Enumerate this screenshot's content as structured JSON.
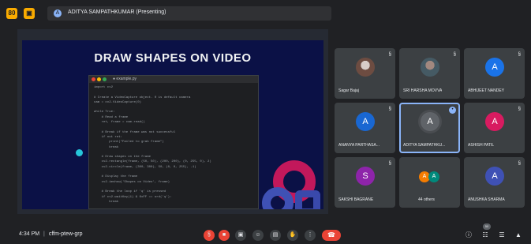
{
  "topbar": {
    "btn1": "80",
    "btn2": "▣",
    "presenter_initial": "A",
    "presenter_text": "ADITYA SAMPATHKUMAR (Presenting)"
  },
  "slide": {
    "title": "DRAW SHAPES ON VIDEO",
    "code_tab": "● example.py",
    "code": "import cv2\n\n# Create a VideoCapture object. 0 is default camera\ncam = cv2.VideoCapture(0)\n\nwhile True:\n    # Read a frame\n    ret, frame = cam.read()\n\n    # Break if the frame was not successful\n    if not ret:\n        print(\"Failed to grab frame\")\n        break\n\n    # Draw shapes on the frame\n    cv2.rectangle(frame, (50, 50), (200, 200), (0, 255, 0), 2)\n    cv2.circle(frame, (300, 300), 50, (0, 0, 255), -1)\n\n    # Display the frame\n    cv2.imshow('Shapes on Video', frame)\n\n    # Break the loop if 'q' is pressed\n    if cv2.waitKey(1) & 0xFF == ord('q'):\n        break\n\n# Release the VideoCapture object and close all windows\ncam.release()\ncv2.destroyAllWindows()"
  },
  "participants": [
    {
      "name": "Sagar Bajaj",
      "avatar": "",
      "muted": "§"
    },
    {
      "name": "SRI HARSHA MOVVA",
      "avatar": "",
      "muted": "§"
    },
    {
      "name": "ABHIJEET NANDEY",
      "avatar": "A",
      "muted": "§",
      "color": "#1a73e8"
    },
    {
      "name": "ANANYA PARTHASA...",
      "avatar": "A",
      "muted": "§",
      "color": "#1967d2"
    },
    {
      "name": "ADITYA SAMPATHKU...",
      "avatar": "A",
      "color": "#5f6368"
    },
    {
      "name": "ASHISH PATIL",
      "avatar": "A",
      "muted": "§",
      "color": "#d81b60"
    },
    {
      "name": "SAKSHI BAGRANE",
      "avatar": "S",
      "muted": "§",
      "color": "#8e24aa"
    },
    {
      "name": "44 others",
      "avatar": ""
    },
    {
      "name": "ANUSHKA SHARMA",
      "avatar": "A",
      "muted": "§",
      "color": "#3f51b5"
    }
  ],
  "others_minis": [
    "A",
    "A"
  ],
  "bottom": {
    "time": "4:34 PM",
    "sep": "|",
    "code": "cffm-ptew-grp",
    "controls": [
      "§",
      "■",
      "▣",
      "☺",
      "▤",
      "✋",
      "⋮"
    ],
    "hangup": "☎",
    "right_icons": [
      "ⓘ",
      "☷",
      "☰",
      "▲"
    ],
    "people_count": "50"
  },
  "colors": {
    "accent": "#8ab4f8",
    "danger": "#ea4335",
    "highlight": "#f9ab00"
  }
}
